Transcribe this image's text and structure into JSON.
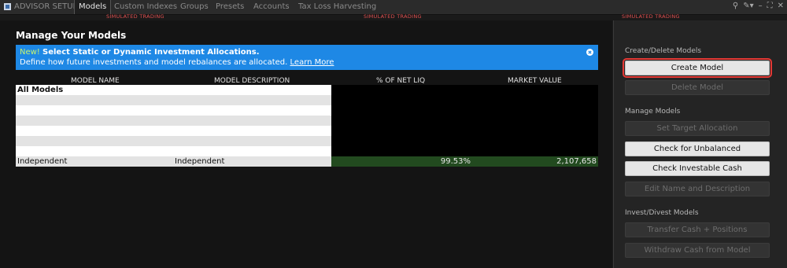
{
  "tabs": [
    {
      "label": "ADVISOR SETUP"
    },
    {
      "label": "Models"
    },
    {
      "label": "Custom Indexes"
    },
    {
      "label": "Groups"
    },
    {
      "label": "Presets"
    },
    {
      "label": "Accounts"
    },
    {
      "label": "Tax Loss Harvesting"
    }
  ],
  "simulated": "SIMULATED TRADING",
  "window_icons": [
    "search-icon",
    "pin-icon",
    "minimize-icon",
    "restore-icon",
    "close-icon"
  ],
  "main": {
    "title": "Manage Your Models",
    "banner": {
      "new_label": "New!",
      "headline": "Select Static or Dynamic Investment Allocations.",
      "text": "Define how future investments and model rebalances are allocated.",
      "link": "Learn More",
      "color": "#1e88e5"
    },
    "table": {
      "columns": [
        "MODEL NAME",
        "MODEL DESCRIPTION",
        "% OF NET LIQ",
        "MARKET VALUE"
      ],
      "header_row": "All Models",
      "rows": [
        {
          "name": "Independent",
          "description": "Independent",
          "pct": "99.53%",
          "value": "2,107,658"
        }
      ]
    }
  },
  "sidebar": {
    "sections": [
      {
        "title": "Create/Delete Models",
        "buttons": [
          {
            "label": "Create Model",
            "enabled": true
          },
          {
            "label": "Delete Model",
            "enabled": false
          }
        ]
      },
      {
        "title": "Manage Models",
        "buttons": [
          {
            "label": "Set Target Allocation",
            "enabled": false
          },
          {
            "label": "Check for Unbalanced",
            "enabled": true
          },
          {
            "label": "Check Investable Cash",
            "enabled": true
          },
          {
            "label": "Edit Name and Description",
            "enabled": false
          }
        ]
      },
      {
        "title": "Invest/Divest Models",
        "buttons": [
          {
            "label": "Transfer Cash + Positions",
            "enabled": false
          },
          {
            "label": "Withdraw Cash from Model",
            "enabled": false
          }
        ]
      }
    ]
  }
}
